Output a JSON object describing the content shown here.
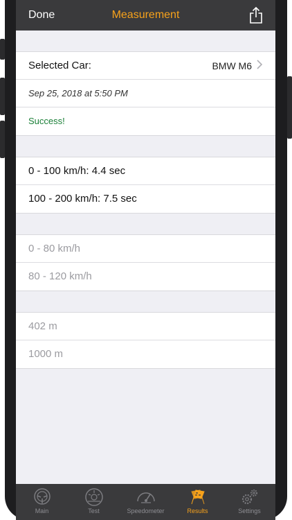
{
  "nav": {
    "done_label": "Done",
    "title": "Measurement"
  },
  "summary": {
    "selected_car_label": "Selected Car:",
    "selected_car_value": "BMW M6",
    "date": "Sep 25, 2018 at 5:50 PM",
    "status": "Success!"
  },
  "results": {
    "row_1": "0 - 100 km/h: 4.4 sec",
    "row_2": "100 - 200 km/h: 7.5 sec"
  },
  "speed_ranges": {
    "row_1": "0 - 80 km/h",
    "row_2": "80 - 120 km/h"
  },
  "distances": {
    "row_1": "402 m",
    "row_2": "1000 m"
  },
  "tabs": [
    {
      "label": "Main",
      "icon": "steering-wheel-icon"
    },
    {
      "label": "Test",
      "icon": "test-gauge-icon"
    },
    {
      "label": "Speedometer",
      "icon": "speedometer-icon"
    },
    {
      "label": "Results",
      "icon": "checkered-flags-icon"
    },
    {
      "label": "Settings",
      "icon": "gears-icon"
    }
  ],
  "colors": {
    "accent": "#f7a21b",
    "bar": "#3a3a3c",
    "success": "#1a7f37"
  }
}
